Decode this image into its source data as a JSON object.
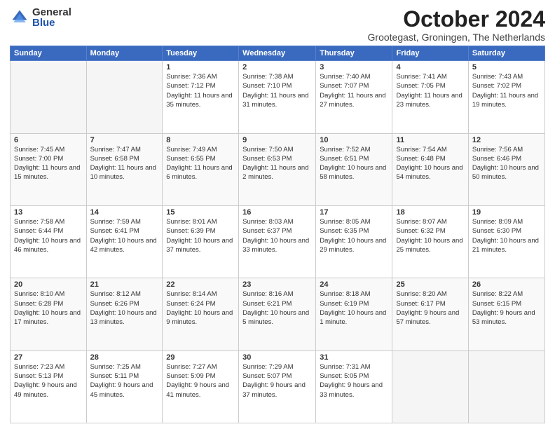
{
  "logo": {
    "general": "General",
    "blue": "Blue"
  },
  "title": "October 2024",
  "subtitle": "Grootegast, Groningen, The Netherlands",
  "headers": [
    "Sunday",
    "Monday",
    "Tuesday",
    "Wednesday",
    "Thursday",
    "Friday",
    "Saturday"
  ],
  "weeks": [
    [
      {
        "day": "",
        "sunrise": "",
        "sunset": "",
        "daylight": ""
      },
      {
        "day": "",
        "sunrise": "",
        "sunset": "",
        "daylight": ""
      },
      {
        "day": "1",
        "sunrise": "Sunrise: 7:36 AM",
        "sunset": "Sunset: 7:12 PM",
        "daylight": "Daylight: 11 hours and 35 minutes."
      },
      {
        "day": "2",
        "sunrise": "Sunrise: 7:38 AM",
        "sunset": "Sunset: 7:10 PM",
        "daylight": "Daylight: 11 hours and 31 minutes."
      },
      {
        "day": "3",
        "sunrise": "Sunrise: 7:40 AM",
        "sunset": "Sunset: 7:07 PM",
        "daylight": "Daylight: 11 hours and 27 minutes."
      },
      {
        "day": "4",
        "sunrise": "Sunrise: 7:41 AM",
        "sunset": "Sunset: 7:05 PM",
        "daylight": "Daylight: 11 hours and 23 minutes."
      },
      {
        "day": "5",
        "sunrise": "Sunrise: 7:43 AM",
        "sunset": "Sunset: 7:02 PM",
        "daylight": "Daylight: 11 hours and 19 minutes."
      }
    ],
    [
      {
        "day": "6",
        "sunrise": "Sunrise: 7:45 AM",
        "sunset": "Sunset: 7:00 PM",
        "daylight": "Daylight: 11 hours and 15 minutes."
      },
      {
        "day": "7",
        "sunrise": "Sunrise: 7:47 AM",
        "sunset": "Sunset: 6:58 PM",
        "daylight": "Daylight: 11 hours and 10 minutes."
      },
      {
        "day": "8",
        "sunrise": "Sunrise: 7:49 AM",
        "sunset": "Sunset: 6:55 PM",
        "daylight": "Daylight: 11 hours and 6 minutes."
      },
      {
        "day": "9",
        "sunrise": "Sunrise: 7:50 AM",
        "sunset": "Sunset: 6:53 PM",
        "daylight": "Daylight: 11 hours and 2 minutes."
      },
      {
        "day": "10",
        "sunrise": "Sunrise: 7:52 AM",
        "sunset": "Sunset: 6:51 PM",
        "daylight": "Daylight: 10 hours and 58 minutes."
      },
      {
        "day": "11",
        "sunrise": "Sunrise: 7:54 AM",
        "sunset": "Sunset: 6:48 PM",
        "daylight": "Daylight: 10 hours and 54 minutes."
      },
      {
        "day": "12",
        "sunrise": "Sunrise: 7:56 AM",
        "sunset": "Sunset: 6:46 PM",
        "daylight": "Daylight: 10 hours and 50 minutes."
      }
    ],
    [
      {
        "day": "13",
        "sunrise": "Sunrise: 7:58 AM",
        "sunset": "Sunset: 6:44 PM",
        "daylight": "Daylight: 10 hours and 46 minutes."
      },
      {
        "day": "14",
        "sunrise": "Sunrise: 7:59 AM",
        "sunset": "Sunset: 6:41 PM",
        "daylight": "Daylight: 10 hours and 42 minutes."
      },
      {
        "day": "15",
        "sunrise": "Sunrise: 8:01 AM",
        "sunset": "Sunset: 6:39 PM",
        "daylight": "Daylight: 10 hours and 37 minutes."
      },
      {
        "day": "16",
        "sunrise": "Sunrise: 8:03 AM",
        "sunset": "Sunset: 6:37 PM",
        "daylight": "Daylight: 10 hours and 33 minutes."
      },
      {
        "day": "17",
        "sunrise": "Sunrise: 8:05 AM",
        "sunset": "Sunset: 6:35 PM",
        "daylight": "Daylight: 10 hours and 29 minutes."
      },
      {
        "day": "18",
        "sunrise": "Sunrise: 8:07 AM",
        "sunset": "Sunset: 6:32 PM",
        "daylight": "Daylight: 10 hours and 25 minutes."
      },
      {
        "day": "19",
        "sunrise": "Sunrise: 8:09 AM",
        "sunset": "Sunset: 6:30 PM",
        "daylight": "Daylight: 10 hours and 21 minutes."
      }
    ],
    [
      {
        "day": "20",
        "sunrise": "Sunrise: 8:10 AM",
        "sunset": "Sunset: 6:28 PM",
        "daylight": "Daylight: 10 hours and 17 minutes."
      },
      {
        "day": "21",
        "sunrise": "Sunrise: 8:12 AM",
        "sunset": "Sunset: 6:26 PM",
        "daylight": "Daylight: 10 hours and 13 minutes."
      },
      {
        "day": "22",
        "sunrise": "Sunrise: 8:14 AM",
        "sunset": "Sunset: 6:24 PM",
        "daylight": "Daylight: 10 hours and 9 minutes."
      },
      {
        "day": "23",
        "sunrise": "Sunrise: 8:16 AM",
        "sunset": "Sunset: 6:21 PM",
        "daylight": "Daylight: 10 hours and 5 minutes."
      },
      {
        "day": "24",
        "sunrise": "Sunrise: 8:18 AM",
        "sunset": "Sunset: 6:19 PM",
        "daylight": "Daylight: 10 hours and 1 minute."
      },
      {
        "day": "25",
        "sunrise": "Sunrise: 8:20 AM",
        "sunset": "Sunset: 6:17 PM",
        "daylight": "Daylight: 9 hours and 57 minutes."
      },
      {
        "day": "26",
        "sunrise": "Sunrise: 8:22 AM",
        "sunset": "Sunset: 6:15 PM",
        "daylight": "Daylight: 9 hours and 53 minutes."
      }
    ],
    [
      {
        "day": "27",
        "sunrise": "Sunrise: 7:23 AM",
        "sunset": "Sunset: 5:13 PM",
        "daylight": "Daylight: 9 hours and 49 minutes."
      },
      {
        "day": "28",
        "sunrise": "Sunrise: 7:25 AM",
        "sunset": "Sunset: 5:11 PM",
        "daylight": "Daylight: 9 hours and 45 minutes."
      },
      {
        "day": "29",
        "sunrise": "Sunrise: 7:27 AM",
        "sunset": "Sunset: 5:09 PM",
        "daylight": "Daylight: 9 hours and 41 minutes."
      },
      {
        "day": "30",
        "sunrise": "Sunrise: 7:29 AM",
        "sunset": "Sunset: 5:07 PM",
        "daylight": "Daylight: 9 hours and 37 minutes."
      },
      {
        "day": "31",
        "sunrise": "Sunrise: 7:31 AM",
        "sunset": "Sunset: 5:05 PM",
        "daylight": "Daylight: 9 hours and 33 minutes."
      },
      {
        "day": "",
        "sunrise": "",
        "sunset": "",
        "daylight": ""
      },
      {
        "day": "",
        "sunrise": "",
        "sunset": "",
        "daylight": ""
      }
    ]
  ]
}
